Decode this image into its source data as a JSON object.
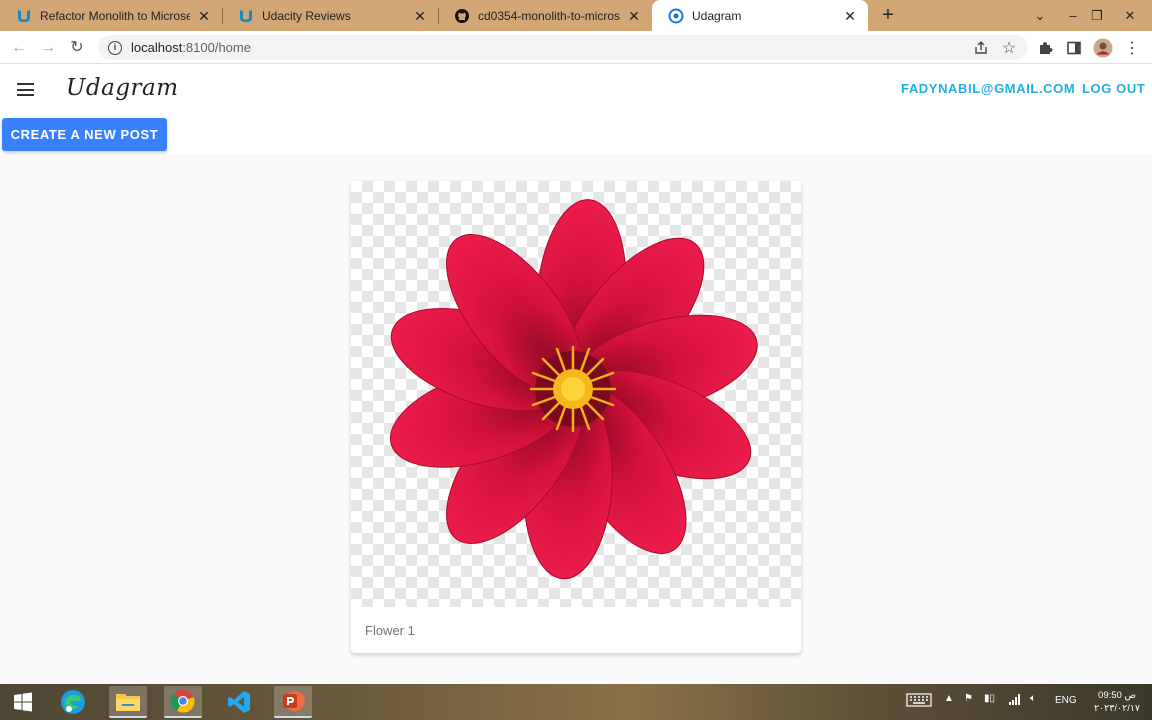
{
  "browser": {
    "tabs": [
      {
        "title": "Refactor Monolith to Microservic",
        "icon": "udacity-icon",
        "active": false
      },
      {
        "title": "Udacity Reviews",
        "icon": "udacity-icon",
        "active": false
      },
      {
        "title": "cd0354-monolith-to-microservic",
        "icon": "github-icon",
        "active": false
      },
      {
        "title": "Udagram",
        "icon": "chrome-page-icon",
        "active": true
      }
    ],
    "url": {
      "host": "localhost",
      "path": ":8100/home"
    },
    "accent": "#d3a675"
  },
  "app": {
    "logo": "Udagram",
    "user_email": "FADYNABIL@GMAIL.COM",
    "logout_label": "LOG OUT",
    "create_post_label": "CREATE A NEW POST",
    "link_color": "#21aee5",
    "primary_color": "#3880ff"
  },
  "feed": {
    "posts": [
      {
        "caption": "Flower 1",
        "image": "red-dahlia-flower"
      }
    ]
  },
  "taskbar": {
    "apps": [
      "windows-start-icon",
      "edge-icon",
      "file-explorer-icon",
      "chrome-icon",
      "vscode-icon",
      "powerpoint-icon"
    ],
    "tray_language": "ENG",
    "time": "09:50 ص",
    "date": "٢٠٢٣/٠٢/١٧"
  }
}
